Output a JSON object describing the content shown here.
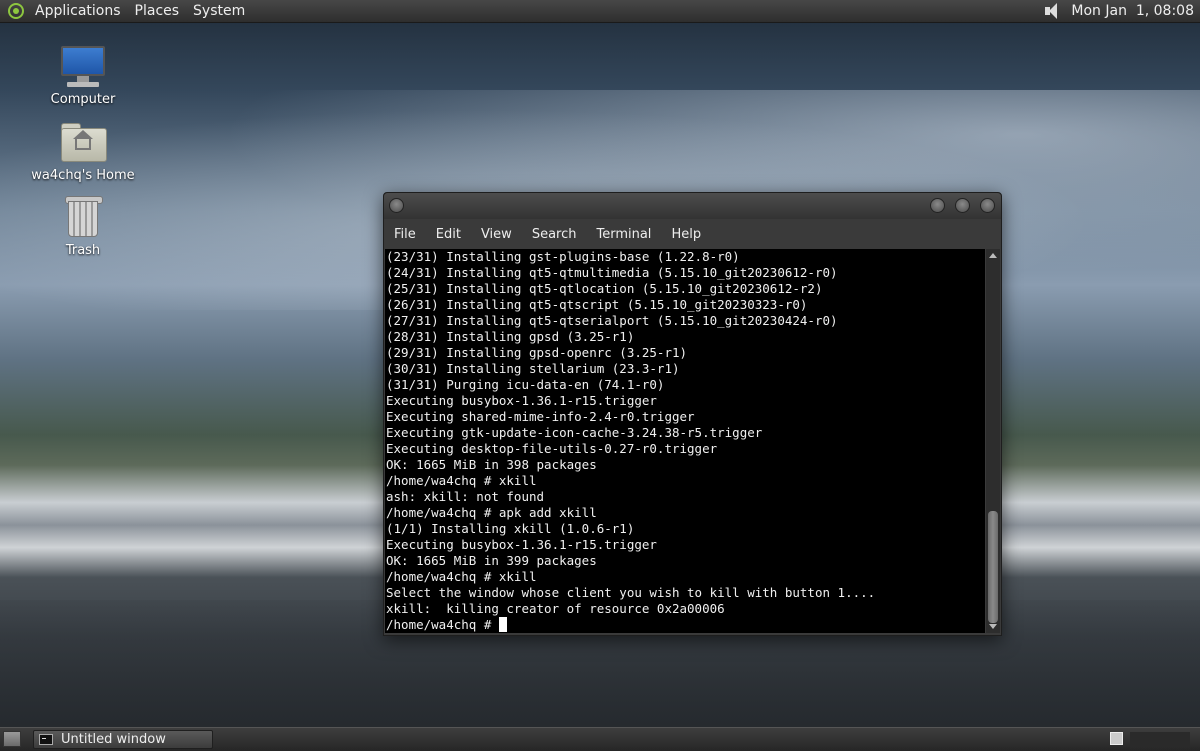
{
  "top_panel": {
    "menus": [
      "Applications",
      "Places",
      "System"
    ],
    "clock": "Mon Jan  1, 08:08"
  },
  "desktop_icons": [
    {
      "label": "Computer",
      "icon": "computer-icon"
    },
    {
      "label": "wa4chq's Home",
      "icon": "home-folder-icon"
    },
    {
      "label": "Trash",
      "icon": "trash-icon"
    }
  ],
  "terminal": {
    "menu": [
      "File",
      "Edit",
      "View",
      "Search",
      "Terminal",
      "Help"
    ],
    "lines": [
      "(23/31) Installing gst-plugins-base (1.22.8-r0)",
      "(24/31) Installing qt5-qtmultimedia (5.15.10_git20230612-r0)",
      "(25/31) Installing qt5-qtlocation (5.15.10_git20230612-r2)",
      "(26/31) Installing qt5-qtscript (5.15.10_git20230323-r0)",
      "(27/31) Installing qt5-qtserialport (5.15.10_git20230424-r0)",
      "(28/31) Installing gpsd (3.25-r1)",
      "(29/31) Installing gpsd-openrc (3.25-r1)",
      "(30/31) Installing stellarium (23.3-r1)",
      "(31/31) Purging icu-data-en (74.1-r0)",
      "Executing busybox-1.36.1-r15.trigger",
      "Executing shared-mime-info-2.4-r0.trigger",
      "Executing gtk-update-icon-cache-3.24.38-r5.trigger",
      "Executing desktop-file-utils-0.27-r0.trigger",
      "OK: 1665 MiB in 398 packages",
      "/home/wa4chq # xkill",
      "ash: xkill: not found",
      "/home/wa4chq # apk add xkill",
      "(1/1) Installing xkill (1.0.6-r1)",
      "Executing busybox-1.36.1-r15.trigger",
      "OK: 1665 MiB in 399 packages",
      "/home/wa4chq # xkill",
      "Select the window whose client you wish to kill with button 1....",
      "xkill:  killing creator of resource 0x2a00006"
    ],
    "prompt": "/home/wa4chq #"
  },
  "taskbar": {
    "window_button": "Untitled window"
  },
  "colors": {
    "terminal_bg": "#000000",
    "terminal_fg": "#f0f0f0",
    "panel_bg": "#3a3a3a"
  }
}
